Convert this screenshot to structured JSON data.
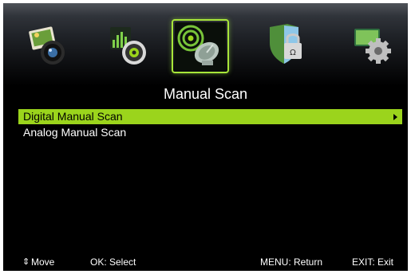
{
  "icons": [
    {
      "name": "picture-icon",
      "selected": false
    },
    {
      "name": "sound-icon",
      "selected": false
    },
    {
      "name": "channel-scan-icon",
      "selected": true
    },
    {
      "name": "lock-icon",
      "selected": false
    },
    {
      "name": "setup-icon",
      "selected": false
    }
  ],
  "title": "Manual Scan",
  "menu": {
    "items": [
      {
        "label": "Digital Manual Scan",
        "highlighted": true,
        "has_arrow": true
      },
      {
        "label": "Analog Manual Scan",
        "highlighted": false,
        "has_arrow": false
      }
    ]
  },
  "footer": {
    "move_icon": "up-down-arrows-icon",
    "move": "Move",
    "select": "OK: Select",
    "return": "MENU: Return",
    "exit": "EXIT: Exit"
  },
  "colors": {
    "highlight": "#9bd41c",
    "background": "#000000",
    "text": "#ffffff"
  }
}
